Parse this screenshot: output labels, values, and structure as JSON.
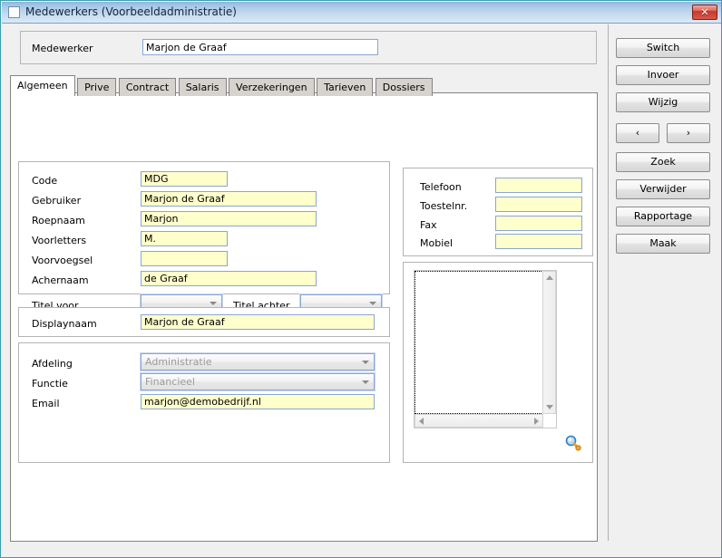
{
  "window": {
    "title": "Medewerkers (Voorbeeldadministratie)",
    "icon": "window-icon",
    "close_label": "✕",
    "accent_titlebar": "#a7c6e4",
    "accent_border": "#3b9fb0",
    "field_fill": "#ffffcc",
    "field_border": "#8aa6d2"
  },
  "header": {
    "label": "Medewerker",
    "value": "Marjon de Graaf",
    "placeholder": ""
  },
  "tabs": [
    {
      "label": "Algemeen",
      "active": true
    },
    {
      "label": "Prive",
      "active": false
    },
    {
      "label": "Contract",
      "active": false
    },
    {
      "label": "Salaris",
      "active": false
    },
    {
      "label": "Verzekeringen",
      "active": false
    },
    {
      "label": "Tarieven",
      "active": false
    },
    {
      "label": "Dossiers",
      "active": false
    }
  ],
  "name_group": {
    "fields": [
      {
        "label": "Code",
        "value": "MDG"
      },
      {
        "label": "Gebruiker",
        "value": "Marjon de Graaf"
      },
      {
        "label": "Roepnaam",
        "value": "Marjon"
      },
      {
        "label": "Voorletters",
        "value": "M."
      },
      {
        "label": "Voorvoegsel",
        "value": ""
      },
      {
        "label": "Achernaam",
        "value": "de Graaf"
      }
    ],
    "title_before": {
      "label": "Titel voor",
      "value": ""
    },
    "title_after": {
      "label": "Titel achter",
      "value": ""
    }
  },
  "display_group": {
    "label": "Displaynaam",
    "value": "Marjon de Graaf"
  },
  "work_group": {
    "department": {
      "label": "Afdeling",
      "value": "Administratie"
    },
    "function": {
      "label": "Functie",
      "value": "Financieel"
    },
    "email": {
      "label": "Email",
      "value": "marjon@demobedrijf.nl"
    }
  },
  "phone_group": {
    "fields": [
      {
        "label": "Telefoon",
        "value": ""
      },
      {
        "label": "Toestelnr.",
        "value": ""
      },
      {
        "label": "Fax",
        "value": ""
      },
      {
        "label": "Mobiel",
        "value": ""
      }
    ]
  },
  "photo_group": {
    "zoom_icon": "magnifier-icon",
    "vscroll_up": "scroll-up-arrow",
    "vscroll_down": "scroll-down-arrow",
    "hscroll_left": "scroll-left-arrow",
    "hscroll_right": "scroll-right-arrow"
  },
  "buttons": {
    "switch": "Switch",
    "invoer": "Invoer",
    "wijzig": "Wijzig",
    "prev": "‹",
    "next": "›",
    "zoek": "Zoek",
    "verwijder": "Verwijder",
    "rapportage": "Rapportage",
    "maak": "Maak"
  }
}
